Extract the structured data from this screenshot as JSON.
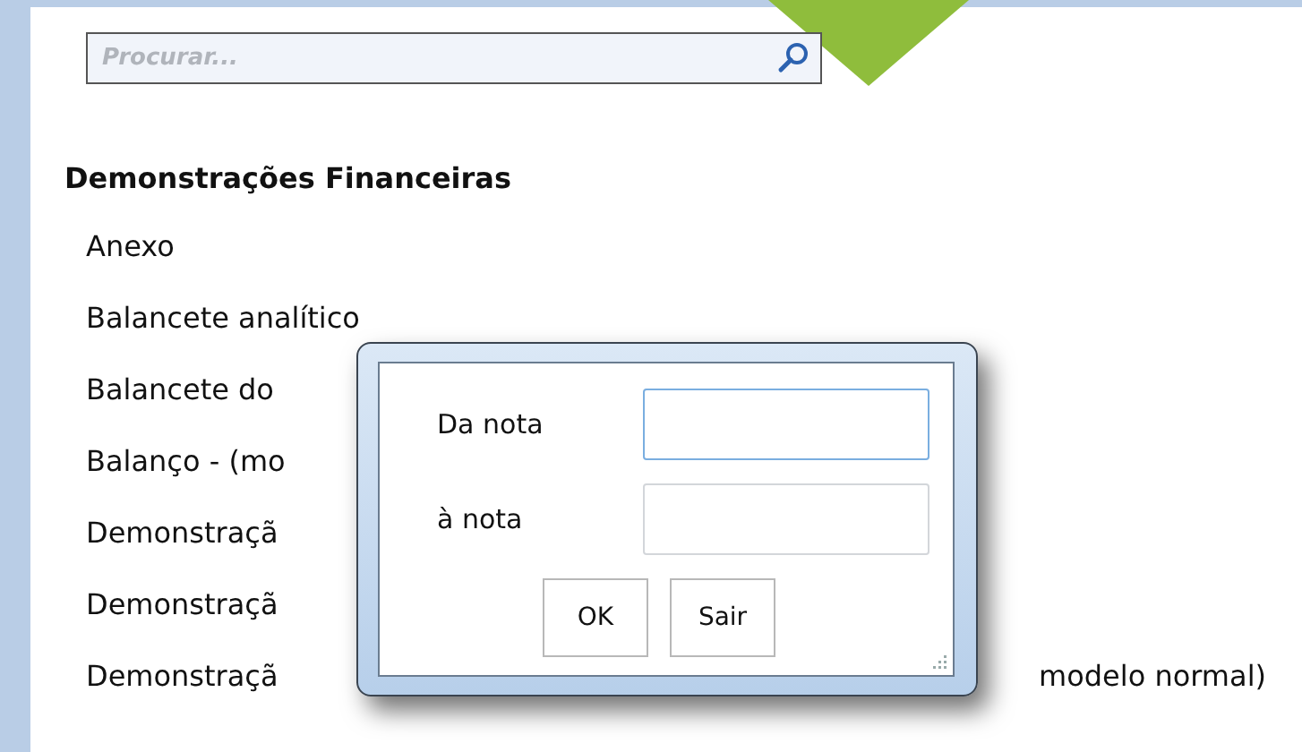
{
  "search": {
    "placeholder": "Procurar..."
  },
  "section": {
    "title": "Demonstrações Financeiras",
    "items": [
      {
        "text": "Anexo"
      },
      {
        "text": "Balancete analítico"
      },
      {
        "text": "Balancete do"
      },
      {
        "text": "Balanço - (mo"
      },
      {
        "text": "Demonstraçã"
      },
      {
        "text": "Demonstraçã"
      },
      {
        "text": "Demonstraçã",
        "tail": "modelo normal)"
      }
    ]
  },
  "dialog": {
    "fields": [
      {
        "label": "Da nota",
        "focused": true
      },
      {
        "label": "à nota",
        "focused": false
      }
    ],
    "buttons": [
      "OK",
      "Sair"
    ]
  }
}
